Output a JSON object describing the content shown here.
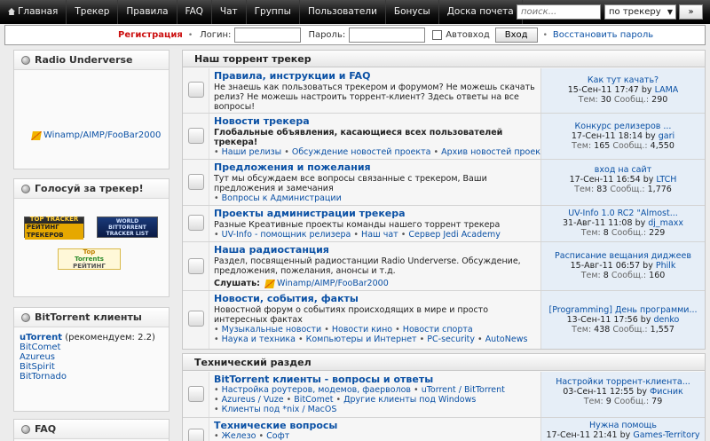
{
  "nav": {
    "items": [
      "Главная",
      "Трекер",
      "Правила",
      "FAQ",
      "Чат",
      "Группы",
      "Пользователи",
      "Бонусы",
      "Доска почета"
    ],
    "search_placeholder": "поиск...",
    "search_scope": "по трекеру",
    "search_go": "»"
  },
  "login": {
    "register": "Регистрация",
    "login_label": "Логин:",
    "password_label": "Пароль:",
    "autologin": "Автовход",
    "submit": "Вход",
    "restore": "Восстановить пароль"
  },
  "sidebar": {
    "radio": {
      "title": "Radio Underverse",
      "link": "Winamp/AIMP/FooBar2000"
    },
    "vote": {
      "title": "Голосуй за трекер!",
      "badge1": [
        "TOP TRACKER",
        "РЕЙТИНГ ТРЕКЕРОВ"
      ],
      "badge2": [
        "WORLD",
        "BITTORRENT",
        "TRACKER LIST"
      ],
      "badge3": [
        "Top",
        "Torrents",
        "РЕЙТИНГ"
      ]
    },
    "clients": {
      "title": "BitTorrent клиенты",
      "recommended": "uTorrent",
      "recommended_note": " (рекомендуем: 2.2)",
      "items": [
        "BitComet",
        "Azureus",
        "BitSpirit",
        "BitTornado"
      ]
    },
    "faq": {
      "title": "FAQ"
    }
  },
  "sections": [
    {
      "title": "Наш торрент трекер",
      "forums": [
        {
          "title": "Правила, инструкции и FAQ",
          "desc": "Не знаешь как пользоваться трекером и форумом? Не можешь скачать релиз? Не можешь настроить торрент-клиент? Здесь ответы на все вопросы!",
          "last": {
            "topic": "Как тут качать?",
            "date": "15-Сен-11 17:47",
            "by": "by",
            "user": "LAMA",
            "topics_label": "Тем:",
            "topics": "30",
            "posts_label": "Сообщ.:",
            "posts": "290"
          }
        },
        {
          "title": "Новости трекера",
          "desc": "Глобальные объявления, касающиеся всех пользователей трекера!",
          "subs": [
            "Наши релизы",
            "Обсуждение новостей проекта",
            "Архив новостей проекта"
          ],
          "last": {
            "topic": "Конкурс релизеров ...",
            "date": "17-Сен-11 18:14",
            "by": "by",
            "user": "gari",
            "topics_label": "Тем:",
            "topics": "165",
            "posts_label": "Сообщ.:",
            "posts": "4,550"
          }
        },
        {
          "title": "Предложения и пожелания",
          "desc": "Тут мы обсуждаем все вопросы связанные с трекером, Ваши предложения и замечания",
          "subs": [
            "Вопросы к Администрации"
          ],
          "last": {
            "topic": "вход на сайт",
            "date": "17-Сен-11 16:54",
            "by": "by",
            "user": "LTCH",
            "topics_label": "Тем:",
            "topics": "83",
            "posts_label": "Сообщ.:",
            "posts": "1,776"
          }
        },
        {
          "title": "Проекты администрации трекера",
          "desc": "Разные Креативные проекты команды нашего торрент трекера",
          "subs": [
            "UV-Info - помощник релизера",
            "Наш чат",
            "Сервер Jedi Academy"
          ],
          "last": {
            "topic": "UV-Info 1.0 RC2 \"Almost...",
            "date": "31-Авг-11 11:08",
            "by": "by",
            "user": "dj_maxx",
            "topics_label": "Тем:",
            "topics": "8",
            "posts_label": "Сообщ.:",
            "posts": "229"
          }
        },
        {
          "title": "Наша радиостанция",
          "desc": "Раздел, посвященный радиостанции Radio Underverse. Обсуждение, предложения, пожелания, анонсы и т.д.",
          "listen_label": "Слушать:",
          "listen_link": "Winamp/AIMP/FooBar2000",
          "last": {
            "topic": "Расписание вещания диджеев",
            "date": "15-Авг-11 06:57",
            "by": "by",
            "user": "Philk",
            "topics_label": "Тем:",
            "topics": "8",
            "posts_label": "Сообщ.:",
            "posts": "160"
          }
        },
        {
          "title": "Новости, события, факты",
          "desc": "Новостной форум о событиях происходящих в мире и просто интересных фактах",
          "subs_line1": [
            "Музыкальные новости",
            "Новости кино",
            "Новости спорта"
          ],
          "subs_line2": [
            "Наука и техника",
            "Компьютеры и Интернет",
            "PC-security",
            "AutoNews"
          ],
          "last": {
            "topic": "[Programming] День программи...",
            "date": "13-Сен-11 17:56",
            "by": "by",
            "user": "denko",
            "topics_label": "Тем:",
            "topics": "438",
            "posts_label": "Сообщ.:",
            "posts": "1,557"
          }
        }
      ]
    },
    {
      "title": "Технический раздел",
      "forums": [
        {
          "title": "BitTorrent клиенты - вопросы и ответы",
          "subs_line1": [
            "Настройка роутеров, модемов, фаерволов",
            "uTorrent / BitTorrent"
          ],
          "subs_line2": [
            "Azureus / Vuze",
            "BitComet",
            "Другие клиенты под Windows"
          ],
          "subs_line3": [
            "Клиенты под *nix / MacOS"
          ],
          "last": {
            "topic": "Настройки торрент-клиента...",
            "date": "03-Сен-11 12:55",
            "by": "by",
            "user": "Фисник",
            "topics_label": "Тем:",
            "topics": "9",
            "posts_label": "Сообщ.:",
            "posts": "79"
          }
        },
        {
          "title": "Технические вопросы",
          "subs": [
            "Железо",
            "Софт"
          ],
          "last": {
            "topic": "Нужна помощь",
            "date": "17-Сен-11 21:41",
            "by": "by",
            "user": "Games-Territory"
          }
        }
      ]
    }
  ]
}
